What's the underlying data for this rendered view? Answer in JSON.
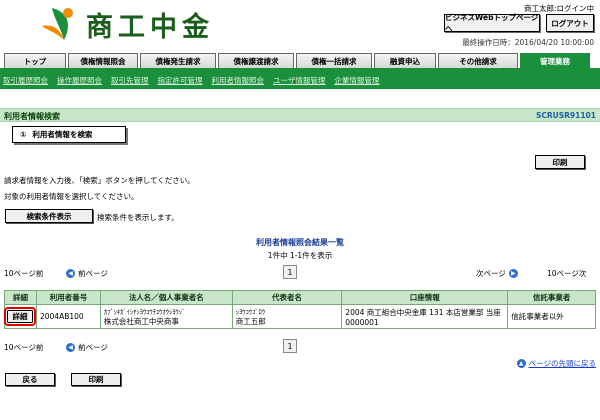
{
  "header": {
    "logo_text": "商工中金",
    "user": "商工太郎:ログイン中",
    "btn_top": "ビジネスWebトップページへ",
    "btn_logout": "ログアウト",
    "last_op": "最終操作日時：2016/04/20 10:00:00"
  },
  "tabs": [
    {
      "label": "トップ",
      "active": false
    },
    {
      "label": "債権情報照会",
      "active": false
    },
    {
      "label": "債権発生請求",
      "active": false
    },
    {
      "label": "債権譲渡請求",
      "active": false
    },
    {
      "label": "債権一括請求",
      "active": false
    },
    {
      "label": "融資申込",
      "active": false
    },
    {
      "label": "その他請求",
      "active": false
    },
    {
      "label": "管理業務",
      "active": true
    }
  ],
  "subnav": [
    "取引履歴照会",
    "操作履歴照会",
    "取引先管理",
    "指定許可管理",
    "利用者情報照会",
    "ユーザ情報管理",
    "企業情報管理"
  ],
  "title": {
    "text": "利用者情報検索",
    "screen_id": "SCRUSR91101"
  },
  "step": {
    "icon": "①",
    "label": "利用者情報を検索"
  },
  "print_label": "印刷",
  "instructions": [
    "請求者情報を入力後、「検索」ボタンを押してください。",
    "対象の利用者情報を選択してください。"
  ],
  "condition": {
    "button": "検索条件表示",
    "text": "検索条件を表示します。"
  },
  "result": {
    "title": "利用者情報照会結果一覧",
    "count": "1件中 1-1件を表示"
  },
  "pager": {
    "prev10": "10ページ前",
    "prev": "前ページ",
    "page": "1",
    "next": "次ページ",
    "next10": "10ページ次"
  },
  "table": {
    "headers": [
      "詳細",
      "利用者番号",
      "法人名／個人事業者名",
      "代表者名",
      "口座情報",
      "信託事業者"
    ],
    "rows": [
      {
        "detail": "詳細",
        "user_no": "2004AB100",
        "corp_kana": "ｶﾌﾞｼｷｶﾞｲｼﾔｼﾖｳｺｳﾁﾕｳｵｳｼﾖｳｼﾞ",
        "corp_name": "株式会社商工中央商事",
        "rep_kana": "ｼﾖｳｺｳｺﾞﾛｳ",
        "rep_name": "商工五郎",
        "account_line1": "2004 商工組合中央金庫 131 本店営業部 当座",
        "account_line2": "0000001",
        "trust": "信託事業者以外"
      }
    ]
  },
  "page_top": "ページの先頭に戻る",
  "back_label": "戻る"
}
